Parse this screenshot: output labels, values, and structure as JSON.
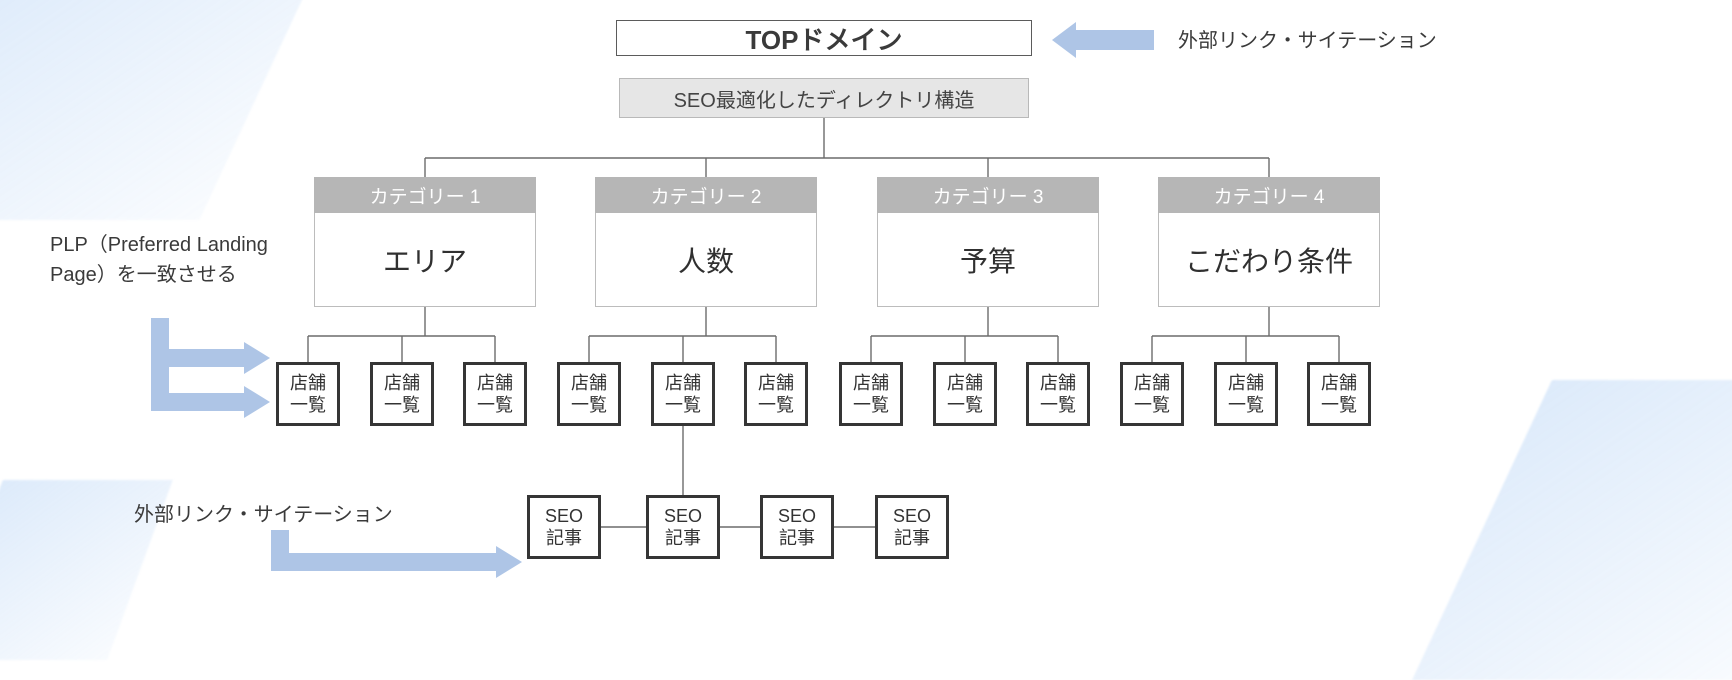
{
  "top_domain": "TOPドメイン",
  "directory_structure": "SEO最適化したディレクトリ構造",
  "categories": [
    {
      "header": "カテゴリー 1",
      "body": "エリア"
    },
    {
      "header": "カテゴリー 2",
      "body": "人数"
    },
    {
      "header": "カテゴリー 3",
      "body": "予算"
    },
    {
      "header": "カテゴリー 4",
      "body": "こだわり条件"
    }
  ],
  "store_label": "店舗\n一覧",
  "seo_label": "SEO\n記事",
  "annotations": {
    "external_link_top": "外部リンク・サイテーション",
    "plp": "PLP（Preferred Landing Page）を一致させる",
    "external_link_bottom": "外部リンク・サイテーション"
  },
  "colors": {
    "arrow_blue": "#aec5e6",
    "category_header_bg": "#b6b6b6",
    "dir_bg": "#e6e6e6"
  }
}
